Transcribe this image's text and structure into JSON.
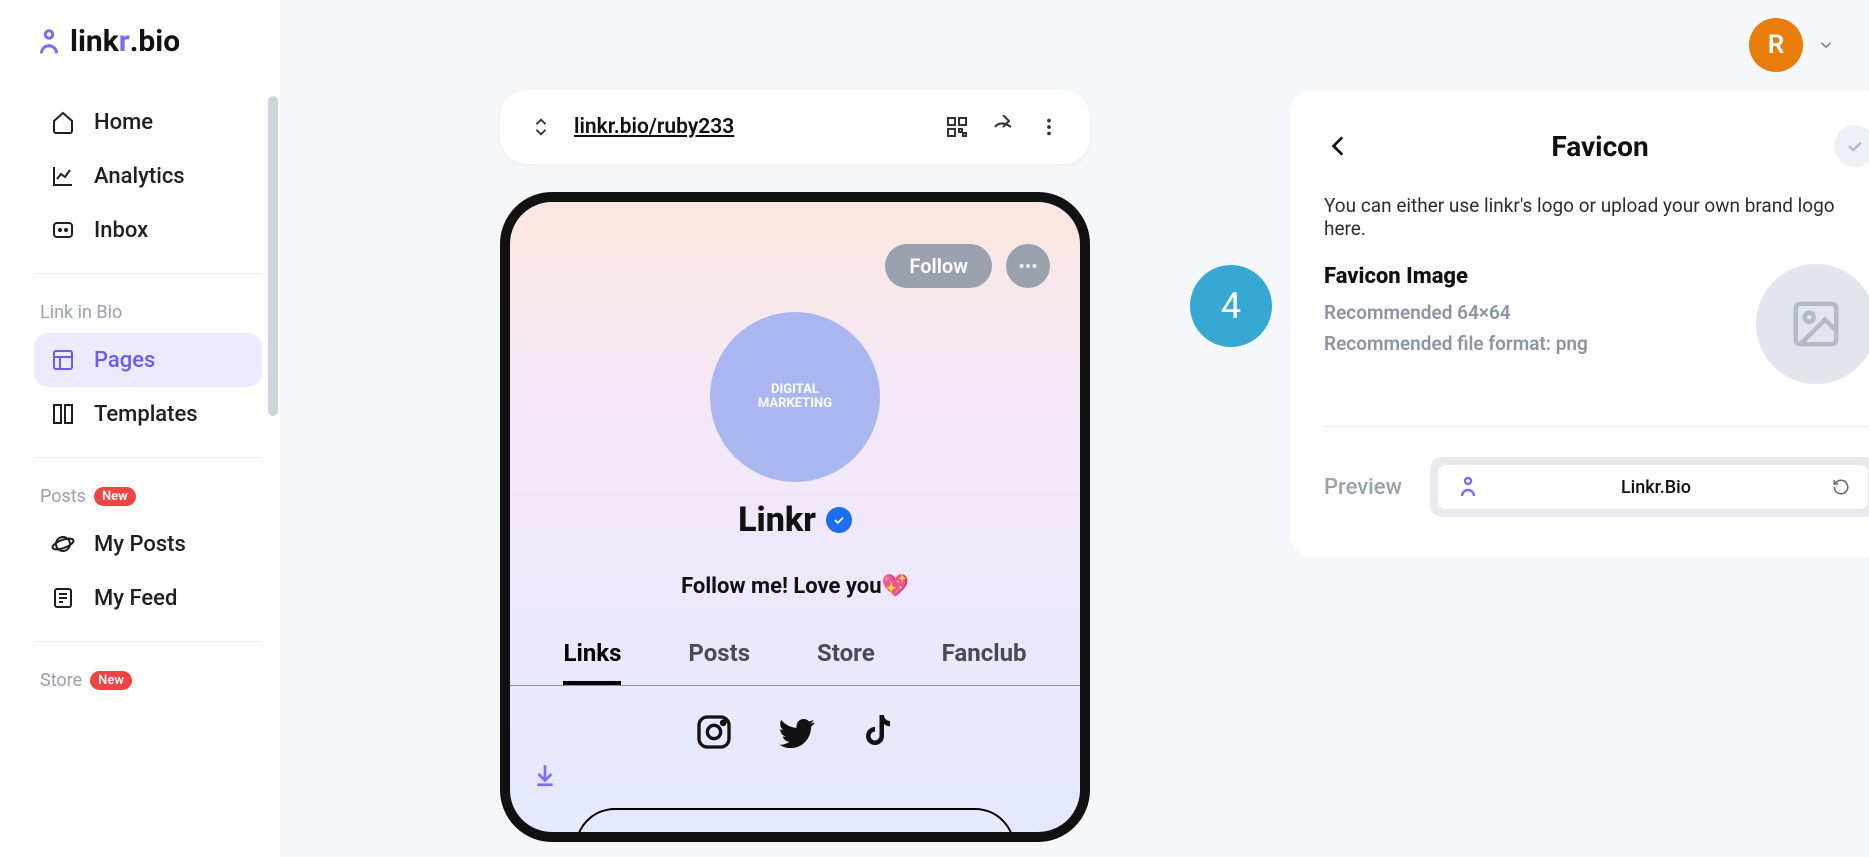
{
  "brand": {
    "name": "linkr.bio",
    "prefix": "link",
    "accent": "r",
    "suffix": ".bio"
  },
  "sidebar": {
    "home": "Home",
    "analytics": "Analytics",
    "inbox": "Inbox",
    "section_linkinbio": "Link in Bio",
    "pages": "Pages",
    "templates": "Templates",
    "section_posts": "Posts",
    "badge_new": "New",
    "myposts": "My Posts",
    "myfeed": "My Feed",
    "section_store": "Store"
  },
  "topbar": {
    "avatar_initial": "R"
  },
  "urlbar": {
    "url": "linkr.bio/ruby233"
  },
  "phone": {
    "follow": "Follow",
    "avatar_line1": "DIGITAL",
    "avatar_line2": "MARKETING",
    "name": "Linkr",
    "bio": "Follow me! Love you💖",
    "tabs": {
      "links": "Links",
      "posts": "Posts",
      "store": "Store",
      "fanclub": "Fanclub"
    }
  },
  "step": "4",
  "panel": {
    "title": "Favicon",
    "desc": "You can either use linkr's logo or upload your own brand logo here.",
    "heading": "Favicon Image",
    "rec_size": "Recommended 64×64",
    "rec_fmt": "Recommended file format: png",
    "preview_label": "Preview",
    "preview_tab_title": "Linkr.Bio"
  }
}
